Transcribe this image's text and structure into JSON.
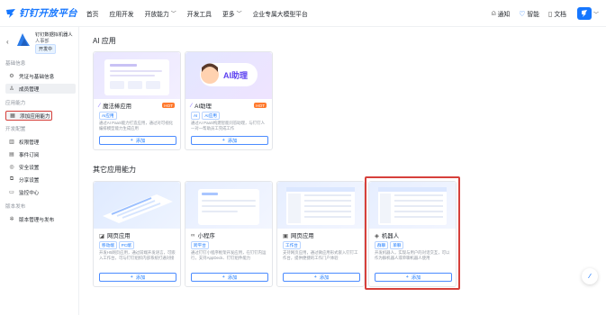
{
  "brand": {
    "name": "钉钉开放平台",
    "color": "#1677ff"
  },
  "nav": {
    "items": [
      {
        "label": "首页",
        "has_menu": false
      },
      {
        "label": "应用开发",
        "has_menu": false
      },
      {
        "label": "开放能力",
        "has_menu": true
      },
      {
        "label": "开发工具",
        "has_menu": false
      },
      {
        "label": "更多",
        "has_menu": true
      },
      {
        "label": "企业专属大模型平台",
        "has_menu": false
      }
    ],
    "right": [
      {
        "label": "通知",
        "icon": "bell-icon"
      },
      {
        "label": "智能",
        "icon": "sparkle-icon"
      },
      {
        "label": "文档",
        "icon": "document-icon"
      }
    ]
  },
  "sidebar": {
    "app": {
      "name": "钉钉数据拟机器人",
      "sub": "人事部",
      "badge": "开发中"
    },
    "sections": [
      {
        "title": "基础信息",
        "items": [
          {
            "label": "凭证与基础信息",
            "icon": "gear-icon"
          },
          {
            "label": "成员管理",
            "icon": "person-icon",
            "active": true
          }
        ]
      },
      {
        "title": "应用能力",
        "items": [
          {
            "label": "添加应用能力",
            "icon": "grid-icon",
            "highlight": true
          }
        ]
      },
      {
        "title": "开发配置",
        "items": [
          {
            "label": "权限管理",
            "icon": "chart-icon"
          },
          {
            "label": "事件订阅",
            "icon": "calendar-icon"
          },
          {
            "label": "安全设置",
            "icon": "shield-icon"
          },
          {
            "label": "分享设置",
            "icon": "share-icon"
          },
          {
            "label": "监控中心",
            "icon": "monitor-icon"
          }
        ]
      },
      {
        "title": "版本发布",
        "items": [
          {
            "label": "版本管理与发布",
            "icon": "version-icon"
          }
        ]
      }
    ]
  },
  "main": {
    "ai_section_title": "AI 应用",
    "other_section_title": "其它应用能力",
    "ai_cards": [
      {
        "name": "魔法棒应用",
        "icon": "magic-wand-icon",
        "hot": "HOT",
        "tags": [
          "AI应用"
        ],
        "desc": "通过AI PaaS能力打造应用，通过对可视化编排模型能力生成应用",
        "add": "添加"
      },
      {
        "name": "AI助理",
        "icon": "ai-assistant-icon",
        "hot": "HOT",
        "tags": [
          "AI",
          "AI应用"
        ],
        "desc": "通过AI PaaS构建智能问答助理，与钉钉人一对一帮助员工完成工作",
        "add": "添加"
      }
    ],
    "ai_thumb_text": "AI助理",
    "other_cards": [
      {
        "name": "网页应用",
        "icon": "web-icon",
        "tags": [
          "移动端",
          "PC端"
        ],
        "desc": "开发H5网页应用，通过前端开发语言，可嵌入工作台，可与钉钉组织内部系统打通对接",
        "add": "添加"
      },
      {
        "name": "小程序",
        "icon": "miniapp-icon",
        "tags": [
          "跨平台"
        ],
        "desc": "通过钉钉小程序框架开发应用，在钉钉内运行，支持AppDeck、钉钉组件能力",
        "add": "添加"
      },
      {
        "name": "网页应用",
        "icon": "page-icon",
        "tags": [
          "工作台"
        ],
        "desc": "支持网页应用，通过微应用形式嵌入钉钉工作台，提供便捷的工作门户体验",
        "add": "添加"
      },
      {
        "name": "机器人",
        "icon": "robot-icon",
        "tags": [
          "群聊",
          "单聊"
        ],
        "desc": "开发机器人，实现与用户的对话交互，可以作为群机器人或单聊机器人使用",
        "add": "添加"
      }
    ]
  },
  "colors": {
    "accent": "#1677ff",
    "hot": "#ff7a2e",
    "highlight_border": "#d6403b"
  }
}
